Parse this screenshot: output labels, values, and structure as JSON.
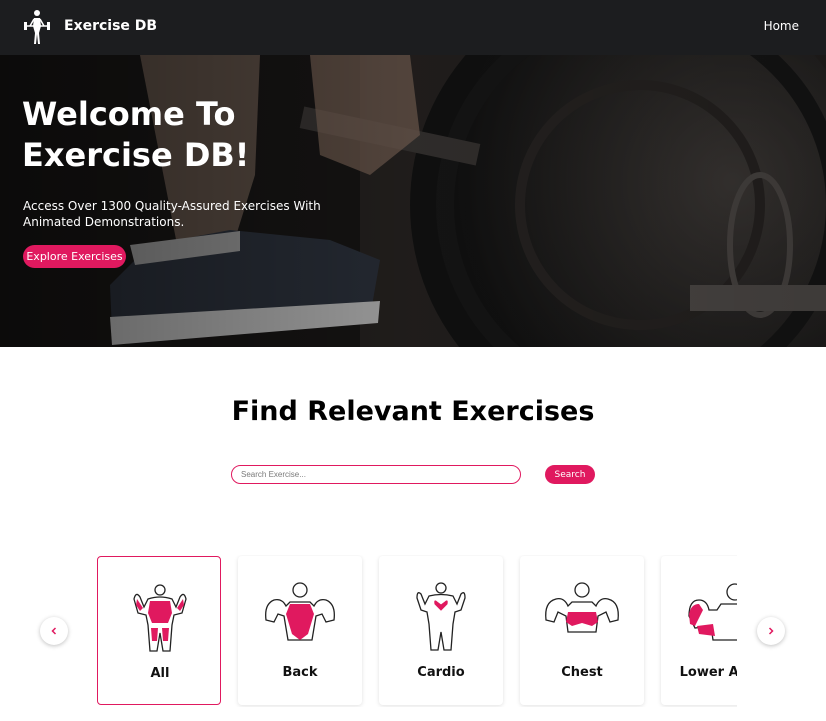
{
  "navbar": {
    "brand": "Exercise DB",
    "home_link": "Home"
  },
  "hero": {
    "title": "Welcome To Exercise DB!",
    "subtitle": "Access Over 1300 Quality-Assured Exercises With Animated Demonstrations.",
    "cta_label": "Explore Exercises"
  },
  "search_section": {
    "title": "Find Relevant Exercises",
    "placeholder": "Search Exercise...",
    "button_label": "Search"
  },
  "body_parts": [
    {
      "label": "All",
      "selected": true,
      "icon": "full-body-icon"
    },
    {
      "label": "Back",
      "selected": false,
      "icon": "back-muscles-icon"
    },
    {
      "label": "Cardio",
      "selected": false,
      "icon": "cardio-heart-icon"
    },
    {
      "label": "Chest",
      "selected": false,
      "icon": "chest-muscles-icon"
    },
    {
      "label": "Lower Arms",
      "selected": false,
      "icon": "lower-arms-icon"
    }
  ],
  "colors": {
    "accent": "#e0195f",
    "navbar": "#1c1d1f",
    "hero_overlay": "#262626"
  }
}
